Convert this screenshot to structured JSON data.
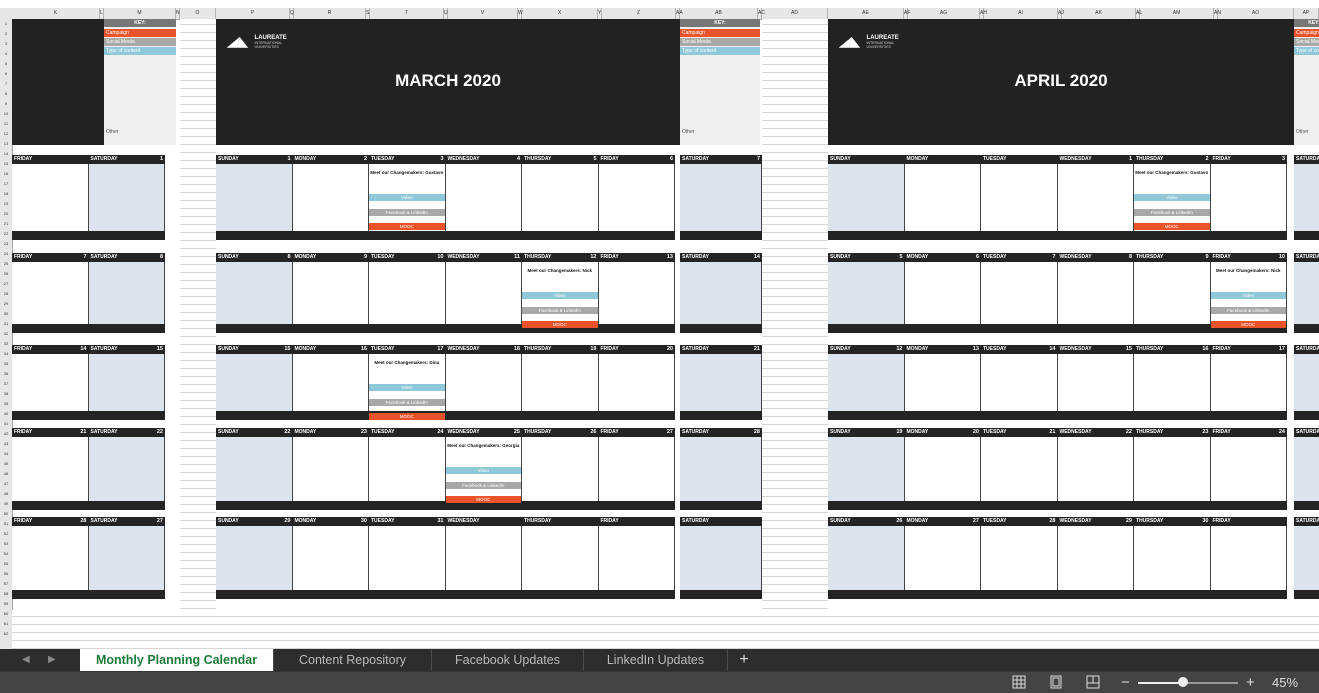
{
  "column_headers": [
    "K",
    "L",
    "M",
    "N",
    "O",
    "P",
    "Q",
    "R",
    "S",
    "T",
    "U",
    "V",
    "W",
    "X",
    "Y",
    "Z",
    "AA",
    "AB",
    "AC",
    "AD",
    "AE",
    "AF",
    "AG",
    "AH",
    "AI",
    "AJ",
    "AK",
    "AL",
    "AM",
    "AN",
    "AO",
    "AP"
  ],
  "row_numbers": [
    "1",
    "2",
    "3",
    "4",
    "5",
    "6",
    "7",
    "8",
    "9",
    "10",
    "11",
    "12",
    "13",
    "14",
    "15",
    "16",
    "17",
    "18",
    "19",
    "20",
    "21",
    "22",
    "23",
    "24",
    "25",
    "26",
    "27",
    "28",
    "29",
    "30",
    "31",
    "32",
    "33",
    "34",
    "35",
    "36",
    "37",
    "38",
    "39",
    "40",
    "41",
    "42",
    "43",
    "44",
    "45",
    "46",
    "47",
    "48",
    "49",
    "50",
    "51",
    "52",
    "53",
    "54",
    "55",
    "56",
    "57",
    "58",
    "59",
    "60",
    "61",
    "62"
  ],
  "key": {
    "title": "KEY:",
    "items": [
      {
        "label": "Campaign",
        "color": "#e8532a"
      },
      {
        "label": "Social Media",
        "color": "#a8a8a8"
      },
      {
        "label": "Type of content",
        "color": "#8fc8d8"
      }
    ],
    "other": "Other"
  },
  "logo": {
    "name": "LAUREATE",
    "line2": "INTERNATIONAL",
    "line3": "UNIVERSITIES"
  },
  "months": [
    {
      "title": "MARCH 2020",
      "days": [
        "SUNDAY",
        "MONDAY",
        "TUESDAY",
        "WEDNESDAY",
        "THURSDAY",
        "FRIDAY",
        "SATURDAY"
      ],
      "weeks": [
        [
          "1",
          "2",
          "3",
          "4",
          "5",
          "6",
          "7"
        ],
        [
          "8",
          "9",
          "10",
          "11",
          "12",
          "13",
          "14"
        ],
        [
          "15",
          "16",
          "17",
          "18",
          "19",
          "20",
          "21"
        ],
        [
          "22",
          "23",
          "24",
          "25",
          "26",
          "27",
          "28"
        ],
        [
          "29",
          "30",
          "31",
          "",
          "",
          "",
          ""
        ]
      ],
      "events": [
        {
          "week": 0,
          "day": 2,
          "title": "Meet our Changemakers: Gustavo",
          "type": "Video",
          "social": "Facebook & LinkedIn",
          "campaign": "MOOC"
        },
        {
          "week": 1,
          "day": 4,
          "title": "Meet our Changemakers: Nick",
          "type": "Video",
          "social": "Facebook & LinkedIn",
          "campaign": "MOOC"
        },
        {
          "week": 2,
          "day": 2,
          "title": "Meet our Changemakers: Dina",
          "type": "Video",
          "social": "Facebook & LinkedIn",
          "campaign": "MOOC"
        },
        {
          "week": 3,
          "day": 3,
          "title": "Meet our Changemakers: Georgia",
          "type": "Video",
          "social": "Facebook & LinkedIn",
          "campaign": "MOOC"
        }
      ]
    },
    {
      "title": "APRIL 2020",
      "days": [
        "SUNDAY",
        "MONDAY",
        "TUESDAY",
        "WEDNESDAY",
        "THURSDAY",
        "FRIDAY",
        "SATURDAY"
      ],
      "weeks": [
        [
          "",
          "",
          "",
          "1",
          "2",
          "3",
          ""
        ],
        [
          "5",
          "6",
          "7",
          "8",
          "9",
          "10",
          ""
        ],
        [
          "12",
          "13",
          "14",
          "15",
          "16",
          "17",
          ""
        ],
        [
          "19",
          "20",
          "21",
          "22",
          "23",
          "24",
          ""
        ],
        [
          "26",
          "27",
          "28",
          "29",
          "30",
          "",
          ""
        ]
      ],
      "events": [
        {
          "week": 0,
          "day": 4,
          "title": "Meet our Changemakers: Gustavo",
          "type": "Video",
          "social": "Facebook & LinkedIn",
          "campaign": "MOOC"
        },
        {
          "week": 1,
          "day": 5,
          "title": "Meet our Changemakers: Nick",
          "type": "Video",
          "social": "Facebook & LinkedIn",
          "campaign": "MOOC"
        }
      ]
    }
  ],
  "prev_month_tail": {
    "days": [
      "FRIDAY",
      "SATURDAY"
    ],
    "weeks": [
      [
        "",
        "1"
      ],
      [
        "7",
        "8"
      ],
      [
        "14",
        "15"
      ],
      [
        "21",
        "22"
      ],
      [
        "28",
        "27"
      ]
    ]
  },
  "sheet_tabs": [
    {
      "label": "Monthly Planning Calendar",
      "active": true
    },
    {
      "label": "Content Repository",
      "active": false
    },
    {
      "label": "Facebook Updates",
      "active": false
    },
    {
      "label": "LinkedIn Updates",
      "active": false
    }
  ],
  "add_sheet_label": "+",
  "zoom": {
    "percent_label": "45%",
    "level": 0.45
  },
  "colors": {
    "header_dark": "#242424",
    "weekend_cell": "#dde3ec",
    "campaign": "#e8532a",
    "social": "#a8a8a8",
    "content_type": "#8fc8d8",
    "active_tab_text": "#1e7a3a"
  }
}
